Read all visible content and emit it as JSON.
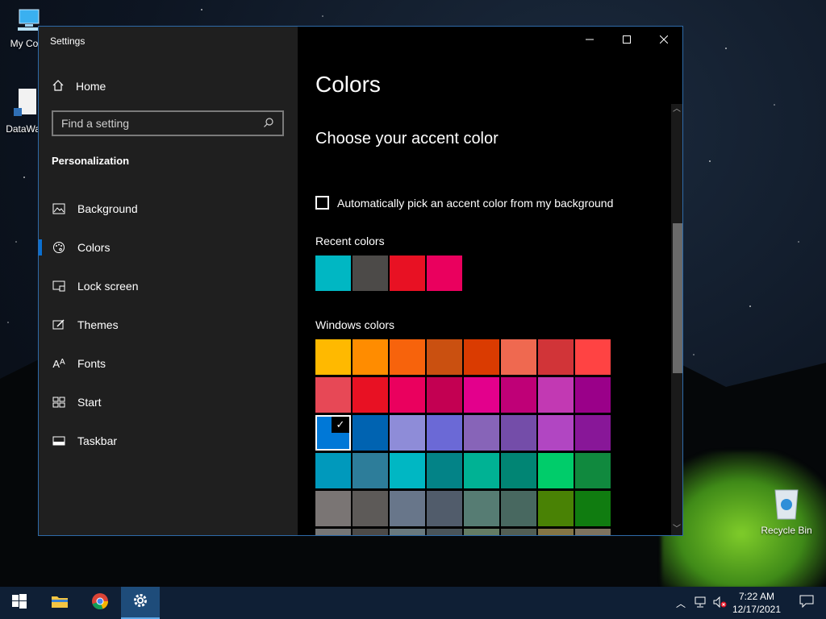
{
  "desktop": {
    "icons": [
      {
        "label": "My Com"
      },
      {
        "label": "DataWag"
      },
      {
        "label": "Recycle Bin"
      }
    ]
  },
  "window": {
    "title": "Settings",
    "controls": {
      "minimize": "—",
      "maximize": "☐",
      "close": "✕"
    }
  },
  "sidebar": {
    "home": "Home",
    "search_placeholder": "Find a setting",
    "section": "Personalization",
    "items": [
      {
        "label": "Background",
        "icon": "background-icon"
      },
      {
        "label": "Colors",
        "icon": "palette-icon",
        "selected": true
      },
      {
        "label": "Lock screen",
        "icon": "lock-screen-icon"
      },
      {
        "label": "Themes",
        "icon": "themes-icon"
      },
      {
        "label": "Fonts",
        "icon": "fonts-icon"
      },
      {
        "label": "Start",
        "icon": "start-icon"
      },
      {
        "label": "Taskbar",
        "icon": "taskbar-icon"
      }
    ]
  },
  "main": {
    "title": "Colors",
    "subtitle": "Choose your accent color",
    "auto_pick_label": "Automatically pick an accent color from my background",
    "auto_pick_checked": false,
    "recent_label": "Recent colors",
    "recent_colors": [
      "#00b7c3",
      "#4c4a48",
      "#e81123",
      "#ea005e"
    ],
    "windows_label": "Windows colors",
    "selected_color": "#0078d7",
    "windows_colors": [
      "#ffb900",
      "#ff8c00",
      "#f7630c",
      "#ca5010",
      "#da3b01",
      "#ef6950",
      "#d13438",
      "#ff4343",
      "#e74856",
      "#e81123",
      "#ea005e",
      "#c30052",
      "#e3008c",
      "#bf0077",
      "#c239b3",
      "#9a0089",
      "#0078d7",
      "#0063b1",
      "#8e8cd8",
      "#6b69d6",
      "#8764b8",
      "#744da9",
      "#b146c2",
      "#881798",
      "#0099bc",
      "#2d7d9a",
      "#00b7c3",
      "#038387",
      "#00b294",
      "#018574",
      "#00cc6a",
      "#10893e",
      "#7a7574",
      "#5d5a58",
      "#68768a",
      "#515c6b",
      "#567c73",
      "#486860",
      "#498205",
      "#107c10",
      "#767676",
      "#4c4a48",
      "#69797e",
      "#4a5459",
      "#647c64",
      "#525e54",
      "#847545",
      "#7e735f"
    ]
  },
  "taskbar": {
    "apps": [
      {
        "name": "start-button"
      },
      {
        "name": "file-explorer"
      },
      {
        "name": "chrome"
      },
      {
        "name": "settings",
        "active": true
      }
    ],
    "time": "7:22 AM",
    "date": "12/17/2021"
  }
}
